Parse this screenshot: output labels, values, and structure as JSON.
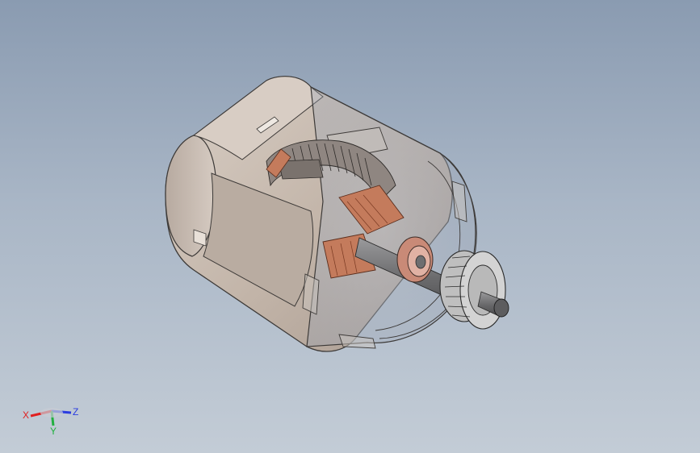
{
  "viewport": {
    "background_top": "#8a9bb1",
    "background_bottom": "#c3ccd6"
  },
  "model": {
    "housing_color": "#c9bcb1",
    "housing_edge_color": "#3d3a38",
    "copper_color": "#c47b5c",
    "shaft_color": "#6f6f70"
  },
  "triad": {
    "x_label": "X",
    "y_label": "Y",
    "z_label": "Z",
    "x_color": "#e02020",
    "y_color": "#22b040",
    "z_color": "#2a3ce0"
  }
}
